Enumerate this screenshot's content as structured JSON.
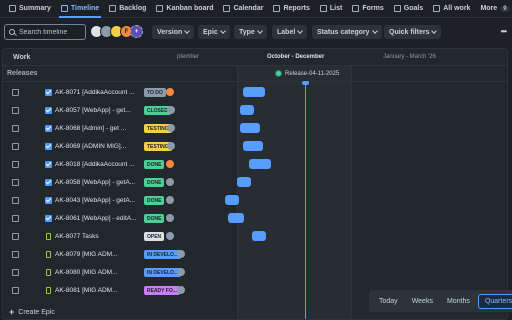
{
  "tabs": [
    {
      "label": "Summary",
      "icon": "globe-icon",
      "active": false
    },
    {
      "label": "Timeline",
      "icon": "timeline-icon",
      "active": true
    },
    {
      "label": "Backlog",
      "icon": "backlog-icon",
      "active": false
    },
    {
      "label": "Kanban board",
      "icon": "board-icon",
      "active": false
    },
    {
      "label": "Calendar",
      "icon": "calendar-icon",
      "active": false
    },
    {
      "label": "Reports",
      "icon": "chart-icon",
      "active": false
    },
    {
      "label": "List",
      "icon": "list-icon",
      "active": false
    },
    {
      "label": "Forms",
      "icon": "form-icon",
      "active": false
    },
    {
      "label": "Goals",
      "icon": "target-icon",
      "active": false
    },
    {
      "label": "All work",
      "icon": "work-icon",
      "active": false
    }
  ],
  "more_tab": {
    "label": "More",
    "count": "9"
  },
  "filters": {
    "search_placeholder": "Search timeline",
    "avatars": [
      "",
      "",
      "",
      "F",
      "+"
    ],
    "buttons": [
      "Version",
      "Epic",
      "Type",
      "Label",
      "Status category",
      "Quick filters"
    ]
  },
  "timeline_header": {
    "work_label": "Work",
    "months": [
      {
        "label": "ptember",
        "current": false
      },
      {
        "label": "October - December",
        "current": true
      },
      {
        "label": "January - March '26",
        "current": false
      }
    ]
  },
  "releases": {
    "label": "Releases",
    "release_name": "Release-04-11-2025"
  },
  "rows": [
    {
      "key_title": "AK-8071 [AddikaAccount ...",
      "status": "TO DO",
      "status_color": "#8c9bab",
      "type": "task",
      "avatar_color": "#f38a3f",
      "start": 0.28,
      "end": 0.39
    },
    {
      "key_title": "AK-8057 [WebApp] - get...",
      "status": "CLOSED",
      "status_color": "#4bce97",
      "type": "task",
      "avatar_color": "#8c9bab",
      "start": 0.27,
      "end": 0.34
    },
    {
      "key_title": "AK-8068 [Admin] - get ...",
      "status": "TESTING",
      "status_color": "#f5cd47",
      "type": "task",
      "avatar_color": "#8c9bab",
      "start": 0.27,
      "end": 0.37
    },
    {
      "key_title": "AK-8069 [ADMIN MIG]...",
      "status": "TESTING",
      "status_color": "#f5cd47",
      "type": "task",
      "avatar_color": "#8c9bab",
      "start": 0.28,
      "end": 0.38
    },
    {
      "key_title": "AK-8018 [AddikaAccount ...",
      "status": "DONE",
      "status_color": "#4bce97",
      "type": "task",
      "avatar_color": "#f38a3f",
      "start": 0.3,
      "end": 0.41
    },
    {
      "key_title": "AK-8058 [WebApp] - getA...",
      "status": "DONE",
      "status_color": "#4bce97",
      "type": "task",
      "avatar_color": "#8c9bab",
      "start": 0.26,
      "end": 0.33
    },
    {
      "key_title": "AK-8043 [WebApp] - getA...",
      "status": "DONE",
      "status_color": "#4bce97",
      "type": "task",
      "avatar_color": "#8c9bab",
      "start": 0.22,
      "end": 0.29
    },
    {
      "key_title": "AK-8061 [WebApp] - editA...",
      "status": "DONE",
      "status_color": "#4bce97",
      "type": "task",
      "avatar_color": "#8c9bab",
      "start": 0.23,
      "end": 0.31
    },
    {
      "key_title": "AK-8077 Tasks",
      "status": "OPEN",
      "status_color": "#dcdfe4",
      "type": "bookmark",
      "avatar_color": "#8c9bab",
      "start": 0.31,
      "end": 0.38
    },
    {
      "key_title": "AK-8079 [MIG ADM...",
      "status": "IN DEVELO...",
      "status_color": "#579dff",
      "type": "bookmark",
      "avatar_color": "#8c9bab",
      "start": null,
      "end": null
    },
    {
      "key_title": "AK-8080 [MIG ADM...",
      "status": "IN DEVELO...",
      "status_color": "#579dff",
      "type": "bookmark",
      "avatar_color": "#8c9bab",
      "start": null,
      "end": null
    },
    {
      "key_title": "AK-8081 [MIG ADM...",
      "status": "READY FO...",
      "status_color": "#c97cf4",
      "type": "bookmark",
      "avatar_color": "#8c9bab",
      "start": null,
      "end": null
    }
  ],
  "create_epic": "Create Epic",
  "zoom": {
    "options": [
      "Today",
      "Weeks",
      "Months",
      "Quarters"
    ],
    "active": "Quarters"
  },
  "colors": {
    "accent": "#579dff",
    "background": "#1d2125",
    "panel": "#22272b"
  }
}
